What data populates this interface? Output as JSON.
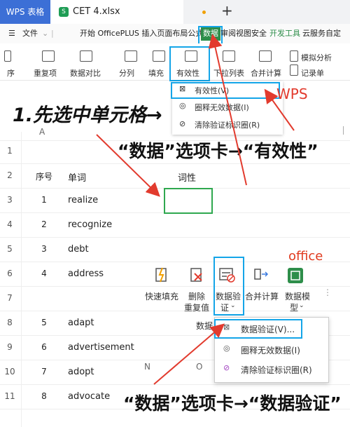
{
  "titlebar": {
    "app_tab": "WPS 表格",
    "file_tab": "CET 4.xlsx",
    "new_tab": "+"
  },
  "menubar": {
    "file": "文件",
    "items": "开始 OfficePLUS 插入页面布局公式",
    "data_tab": "数据",
    "items_after": "审阅视图安全",
    "dev": "开发工具",
    "cloud": "云服务自定"
  },
  "toolbar": {
    "items": [
      "序",
      "重复项",
      "数据对比",
      "分列",
      "填充",
      "有效性",
      "下拉列表",
      "合并计算",
      "模拟分析",
      "记录单"
    ]
  },
  "wps_dropdown": {
    "items": [
      "有效性(V)",
      "圈释无效数据(I)",
      "清除验证标识圈(R)"
    ]
  },
  "annotations": {
    "step1": "1.先选中单元格→",
    "wps": "WPS",
    "wps_path": "“数据”选项卡→“有效性”",
    "office": "office",
    "office_path": "“数据”选项卡→“数据验证”"
  },
  "columns": {
    "a": "A",
    "n": "N",
    "o": "O"
  },
  "headers": {
    "index": "序号",
    "word": "单词",
    "pos": "词性"
  },
  "rows": [
    {
      "n": "1",
      "a": "",
      "b": ""
    },
    {
      "n": "2",
      "a": "序号",
      "b": "单词"
    },
    {
      "n": "3",
      "a": "1",
      "b": "realize"
    },
    {
      "n": "4",
      "a": "2",
      "b": "recognize"
    },
    {
      "n": "5",
      "a": "3",
      "b": "debt"
    },
    {
      "n": "6",
      "a": "4",
      "b": "address"
    },
    {
      "n": "7",
      "a": "",
      "b": ""
    },
    {
      "n": "8",
      "a": "5",
      "b": "adapt"
    },
    {
      "n": "9",
      "a": "6",
      "b": "advertisement"
    },
    {
      "n": "10",
      "a": "7",
      "b": "adopt"
    },
    {
      "n": "11",
      "a": "8",
      "b": "advocate"
    }
  ],
  "office_ribbon": {
    "quick_fill": "快速填充",
    "remove_dup_1": "删除",
    "remove_dup_2": "重复值",
    "validate_1": "数据验",
    "validate_2": "证",
    "consolidate": "合并计算",
    "model_1": "数据模",
    "model_2": "型",
    "data_partial": "数据"
  },
  "office_dropdown": {
    "items": [
      "数据验证(V)...",
      "圈释无效数据(I)",
      "清除验证标识圈(R)"
    ]
  },
  "colors": {
    "wps_blue": "#3c6fd6",
    "data_green": "#2e8e4a",
    "highlight_blue": "#14a5e8",
    "arrow_red": "#e23b2e",
    "office_red": "#e03a1e"
  }
}
